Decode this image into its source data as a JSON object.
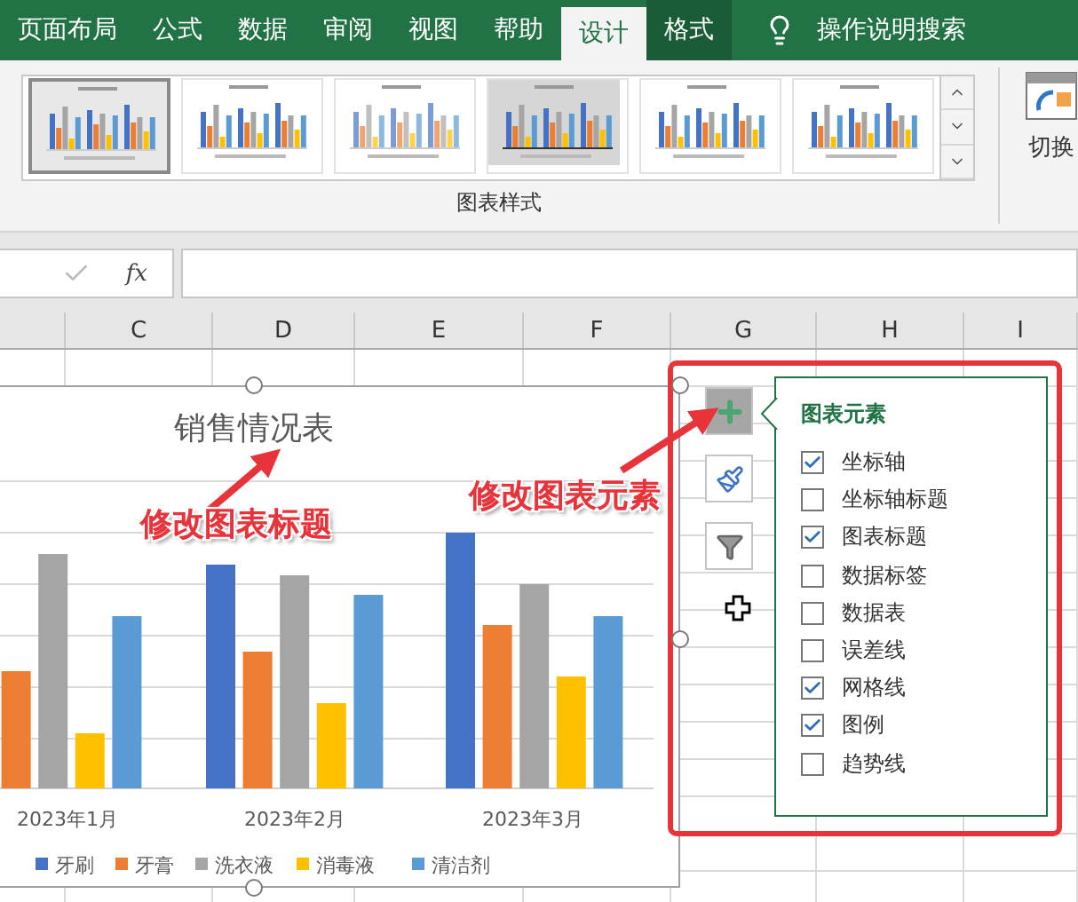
{
  "ribbon_tabs": [
    {
      "label": "页面布局",
      "selected": false,
      "kind": "normal"
    },
    {
      "label": "公式",
      "selected": false,
      "kind": "normal"
    },
    {
      "label": "数据",
      "selected": false,
      "kind": "normal"
    },
    {
      "label": "审阅",
      "selected": false,
      "kind": "normal"
    },
    {
      "label": "视图",
      "selected": false,
      "kind": "normal"
    },
    {
      "label": "帮助",
      "selected": false,
      "kind": "normal"
    },
    {
      "label": "设计",
      "selected": true,
      "kind": "normal"
    },
    {
      "label": "格式",
      "selected": false,
      "kind": "contextual"
    }
  ],
  "tell_me": {
    "label": "操作说明搜索"
  },
  "chart_styles": {
    "label": "图表样式",
    "styles": [
      {
        "selected": true
      },
      {
        "selected": false
      },
      {
        "selected": false
      },
      {
        "selected": false
      },
      {
        "selected": false
      },
      {
        "selected": false
      }
    ]
  },
  "switch_button": {
    "label": "切换"
  },
  "formula_bar": {
    "fx_label": "fx"
  },
  "columns": [
    "C",
    "D",
    "E",
    "F",
    "G",
    "H",
    "I"
  ],
  "chart": {
    "title": "销售情况表",
    "categories": [
      "2023年1月",
      "2023年2月",
      "2023年3月"
    ],
    "legend": [
      {
        "name": "牙刷",
        "color": "#4472c4"
      },
      {
        "name": "牙膏",
        "color": "#ed7d31"
      },
      {
        "name": "洗衣液",
        "color": "#a5a5a5"
      },
      {
        "name": "消毒液",
        "color": "#ffc000"
      },
      {
        "name": "清洁剂",
        "color": "#5b9bd5"
      }
    ]
  },
  "side_buttons": [
    {
      "kind": "elements",
      "selected": true
    },
    {
      "kind": "styles",
      "selected": false
    },
    {
      "kind": "filter",
      "selected": false
    }
  ],
  "chart_elements": {
    "title": "图表元素",
    "items": [
      {
        "label": "坐标轴",
        "checked": true
      },
      {
        "label": "坐标轴标题",
        "checked": false
      },
      {
        "label": "图表标题",
        "checked": true
      },
      {
        "label": "数据标签",
        "checked": false
      },
      {
        "label": "数据表",
        "checked": false
      },
      {
        "label": "误差线",
        "checked": false
      },
      {
        "label": "网格线",
        "checked": true
      },
      {
        "label": "图例",
        "checked": true
      },
      {
        "label": "趋势线",
        "checked": false
      }
    ]
  },
  "annotations": [
    {
      "text": "修改图表标题"
    },
    {
      "text": "修改图表元素"
    }
  ]
}
